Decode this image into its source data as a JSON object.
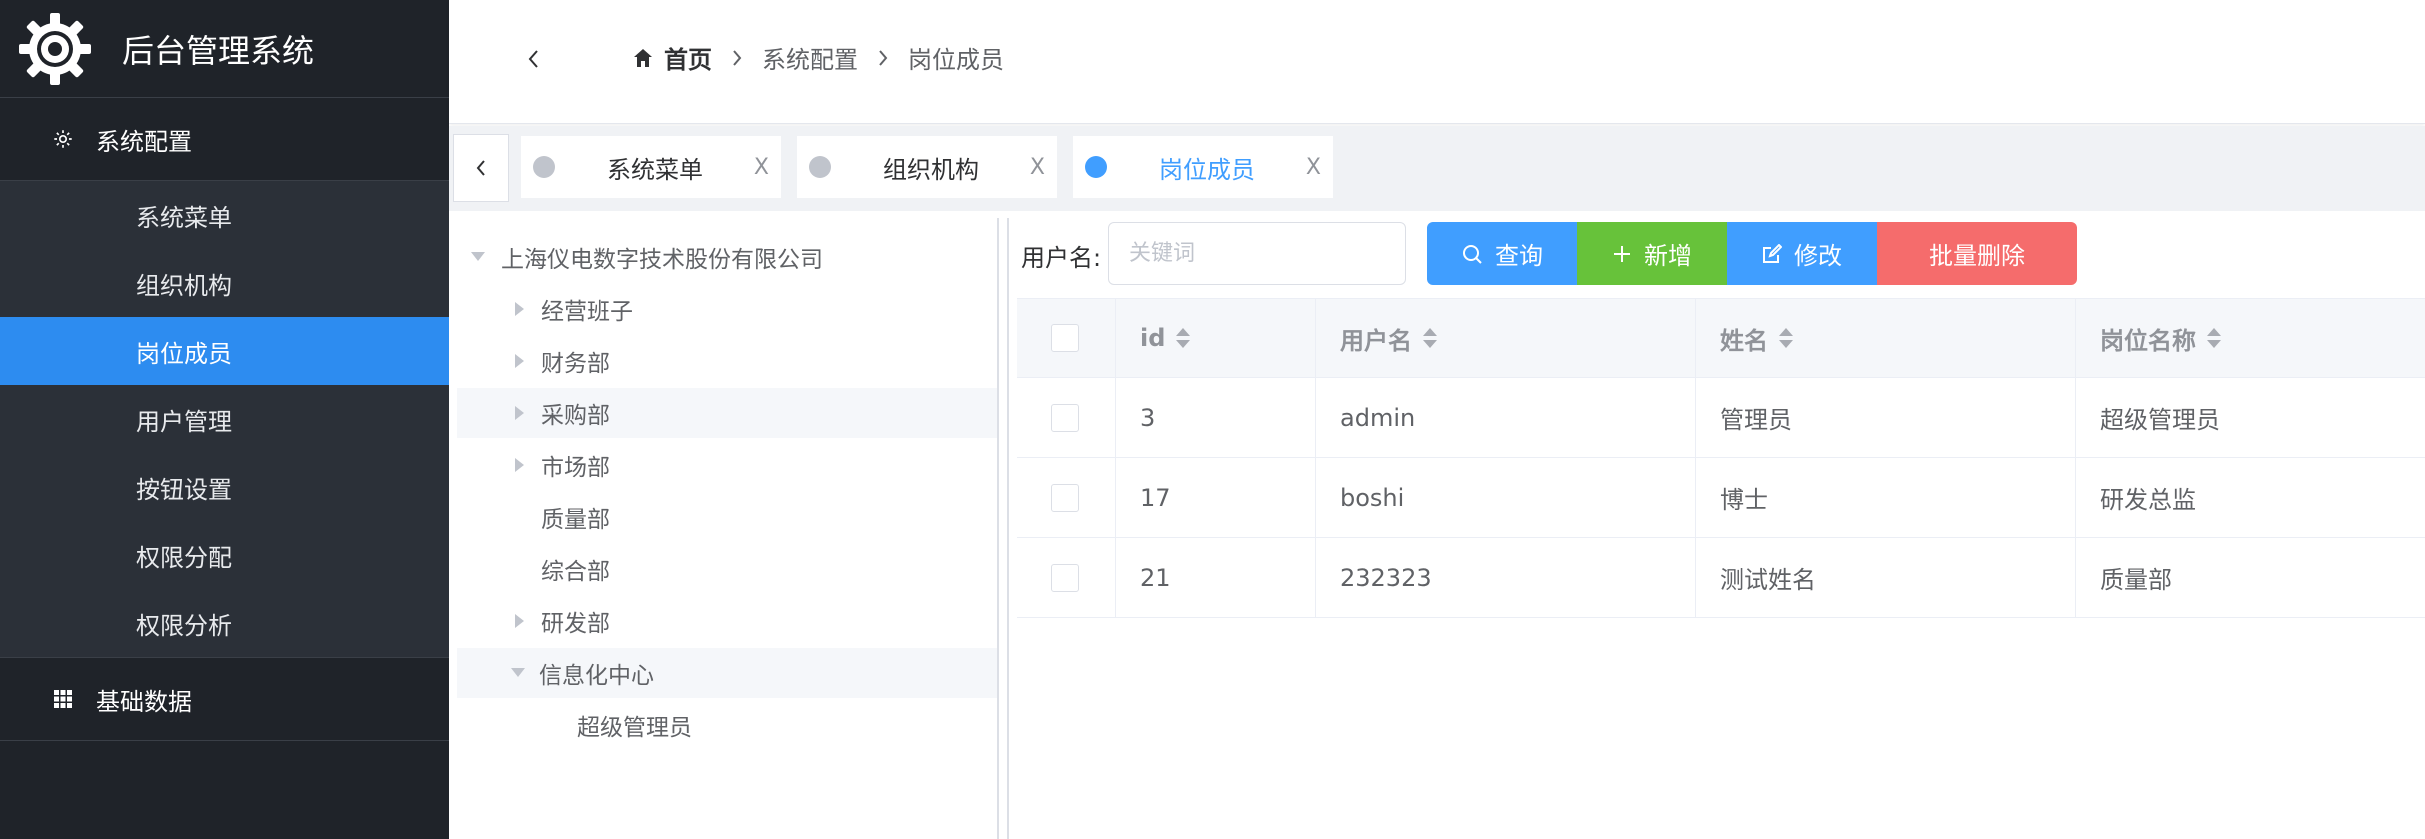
{
  "app": {
    "title": "后台管理系统"
  },
  "sidebar": {
    "group1": "系统配置",
    "items": [
      {
        "label": "系统菜单"
      },
      {
        "label": "组织机构"
      },
      {
        "label": "岗位成员"
      },
      {
        "label": "用户管理"
      },
      {
        "label": "按钮设置"
      },
      {
        "label": "权限分配"
      },
      {
        "label": "权限分析"
      }
    ],
    "group2": "基础数据",
    "active_item": "岗位成员"
  },
  "breadcrumb": {
    "home": "首页",
    "items": [
      "系统配置",
      "岗位成员"
    ]
  },
  "tabs": [
    {
      "label": "系统菜单",
      "close": "X",
      "active": false
    },
    {
      "label": "组织机构",
      "close": "X",
      "active": false
    },
    {
      "label": "岗位成员",
      "close": "X",
      "active": true
    }
  ],
  "tree": {
    "root": "上海仪电数字技术股份有限公司",
    "nodes": [
      {
        "label": "经营班子",
        "expandable": true
      },
      {
        "label": "财务部",
        "expandable": true
      },
      {
        "label": "采购部",
        "expandable": true
      },
      {
        "label": "市场部",
        "expandable": true
      },
      {
        "label": "质量部",
        "expandable": false
      },
      {
        "label": "综合部",
        "expandable": false
      },
      {
        "label": "研发部",
        "expandable": true
      },
      {
        "label": "信息化中心",
        "expandable": true,
        "expanded": true
      }
    ],
    "leaf": "超级管理员"
  },
  "search": {
    "label": "用户名:",
    "placeholder": "关键词",
    "value": ""
  },
  "toolbar": {
    "query": "查询",
    "add": "新增",
    "edit": "修改",
    "batch_delete": "批量删除"
  },
  "table": {
    "columns": [
      "id",
      "用户名",
      "姓名",
      "岗位名称"
    ],
    "rows": [
      {
        "id": "3",
        "username": "admin",
        "name": "管理员",
        "position": "超级管理员"
      },
      {
        "id": "17",
        "username": "boshi",
        "name": "博士",
        "position": "研发总监"
      },
      {
        "id": "21",
        "username": "232323",
        "name": "测试姓名",
        "position": "质量部"
      }
    ]
  },
  "colors": {
    "sidebar_bg": "#1f2329",
    "submenu_bg": "#2b3038",
    "primary": "#409eff",
    "active_menu": "#2d8cf0",
    "success": "#67c23a",
    "danger": "#f56c6c"
  }
}
